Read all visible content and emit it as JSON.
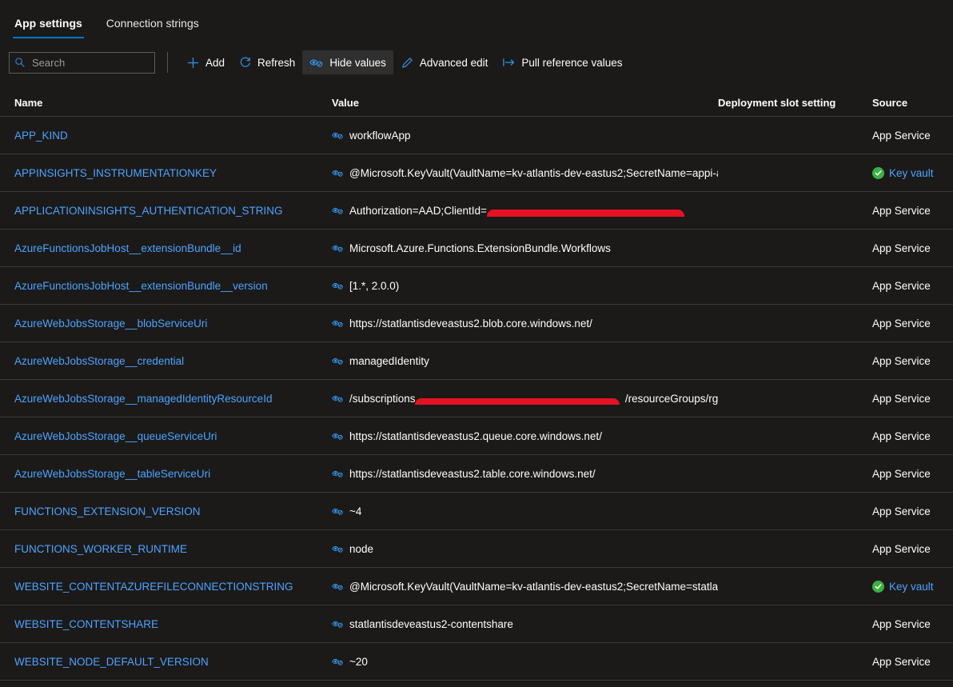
{
  "tabs": [
    {
      "label": "App settings",
      "active": true
    },
    {
      "label": "Connection strings",
      "active": false
    }
  ],
  "search": {
    "value": "",
    "placeholder": "Search"
  },
  "toolbar": {
    "add_label": "Add",
    "refresh_label": "Refresh",
    "hide_values_label": "Hide values",
    "advanced_edit_label": "Advanced edit",
    "pull_reference_values_label": "Pull reference values"
  },
  "colors": {
    "accent": "#0078d4",
    "link": "#4da3ff",
    "background": "#1b1a19",
    "row_divider": "#3b3a39",
    "success_green": "#3bb143",
    "redaction_red": "#e81123",
    "active_command_bg": "#2f2f2f"
  },
  "table": {
    "columns": [
      "Name",
      "Value",
      "Deployment slot setting",
      "Source"
    ],
    "rows": [
      {
        "name": "APP_KIND",
        "value": "workflowApp",
        "slot": "",
        "source": "App Service",
        "source_kind": "app-service",
        "redacted": false
      },
      {
        "name": "APPINSIGHTS_INSTRUMENTATIONKEY",
        "value": "@Microsoft.KeyVault(VaultName=kv-atlantis-dev-eastus2;SecretName=appi-a",
        "slot": "",
        "source": "Key vault",
        "source_kind": "key-vault",
        "redacted": false
      },
      {
        "name": "APPLICATIONINSIGHTS_AUTHENTICATION_STRING",
        "value": "Authorization=AAD;ClientId=",
        "slot": "",
        "source": "App Service",
        "source_kind": "app-service",
        "redacted": true
      },
      {
        "name": "AzureFunctionsJobHost__extensionBundle__id",
        "value": "Microsoft.Azure.Functions.ExtensionBundle.Workflows",
        "slot": "",
        "source": "App Service",
        "source_kind": "app-service",
        "redacted": false
      },
      {
        "name": "AzureFunctionsJobHost__extensionBundle__version",
        "value": "[1.*, 2.0.0)",
        "slot": "",
        "source": "App Service",
        "source_kind": "app-service",
        "redacted": false
      },
      {
        "name": "AzureWebJobsStorage__blobServiceUri",
        "value": "https://statlantisdeveastus2.blob.core.windows.net/",
        "slot": "",
        "source": "App Service",
        "source_kind": "app-service",
        "redacted": false
      },
      {
        "name": "AzureWebJobsStorage__credential",
        "value": "managedIdentity",
        "slot": "",
        "source": "App Service",
        "source_kind": "app-service",
        "redacted": false
      },
      {
        "name": "AzureWebJobsStorage__managedIdentityResourceId",
        "value": "/subscriptions,",
        "value_suffix": "/resourceGroups/rg-",
        "slot": "",
        "source": "App Service",
        "source_kind": "app-service",
        "redacted": true
      },
      {
        "name": "AzureWebJobsStorage__queueServiceUri",
        "value": "https://statlantisdeveastus2.queue.core.windows.net/",
        "slot": "",
        "source": "App Service",
        "source_kind": "app-service",
        "redacted": false
      },
      {
        "name": "AzureWebJobsStorage__tableServiceUri",
        "value": "https://statlantisdeveastus2.table.core.windows.net/",
        "slot": "",
        "source": "App Service",
        "source_kind": "app-service",
        "redacted": false
      },
      {
        "name": "FUNCTIONS_EXTENSION_VERSION",
        "value": "~4",
        "slot": "",
        "source": "App Service",
        "source_kind": "app-service",
        "redacted": false
      },
      {
        "name": "FUNCTIONS_WORKER_RUNTIME",
        "value": "node",
        "slot": "",
        "source": "App Service",
        "source_kind": "app-service",
        "redacted": false
      },
      {
        "name": "WEBSITE_CONTENTAZUREFILECONNECTIONSTRING",
        "value": "@Microsoft.KeyVault(VaultName=kv-atlantis-dev-eastus2;SecretName=statlan",
        "slot": "",
        "source": "Key vault",
        "source_kind": "key-vault",
        "redacted": false
      },
      {
        "name": "WEBSITE_CONTENTSHARE",
        "value": "statlantisdeveastus2-contentshare",
        "slot": "",
        "source": "App Service",
        "source_kind": "app-service",
        "redacted": false
      },
      {
        "name": "WEBSITE_NODE_DEFAULT_VERSION",
        "value": "~20",
        "slot": "",
        "source": "App Service",
        "source_kind": "app-service",
        "redacted": false
      }
    ]
  },
  "icons": {
    "search": "search-icon",
    "add": "plus-icon",
    "refresh": "refresh-icon",
    "hide_values": "eye-slash-icon",
    "advanced_edit": "pencil-icon",
    "pull_reference_values": "pull-arrow-icon",
    "value_toggle": "eye-slash-icon",
    "key_vault_status": "check-circle-icon"
  }
}
